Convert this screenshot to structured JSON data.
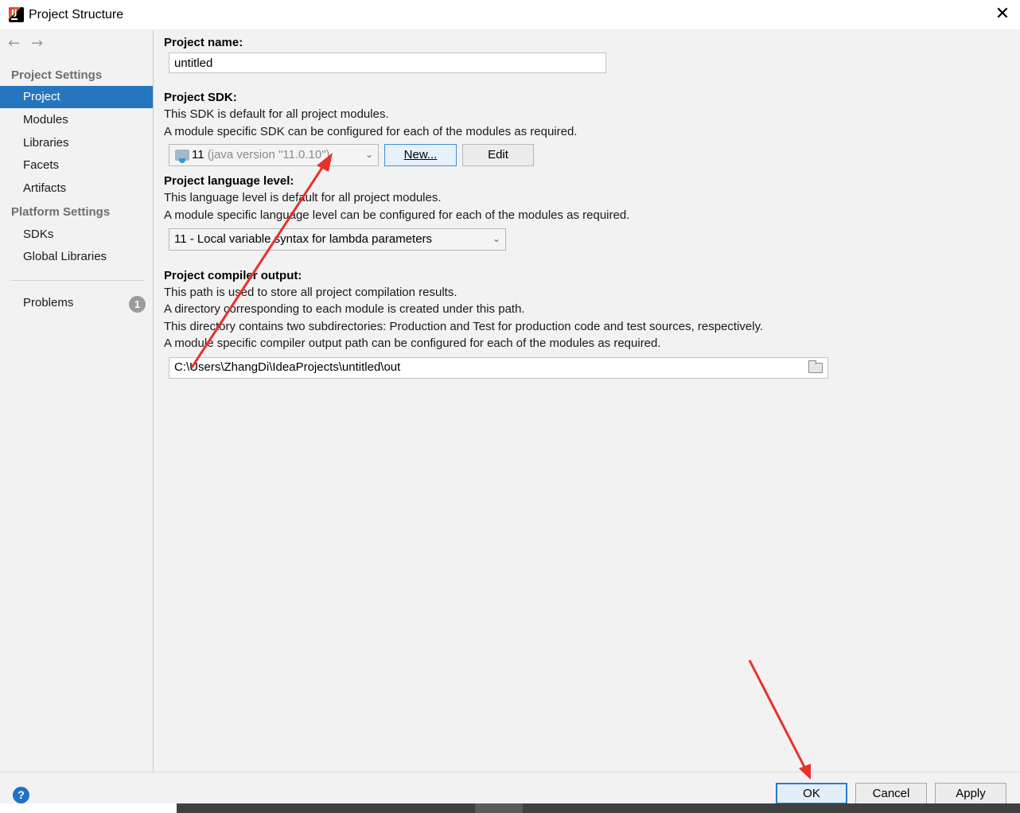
{
  "window": {
    "title": "Project Structure",
    "close_glyph": "✕"
  },
  "sidebar": {
    "back_glyph": "←",
    "forward_glyph": "→",
    "project_settings_title": "Project Settings",
    "project_items": [
      "Project",
      "Modules",
      "Libraries",
      "Facets",
      "Artifacts"
    ],
    "platform_settings_title": "Platform Settings",
    "platform_items": [
      "SDKs",
      "Global Libraries"
    ],
    "problems_label": "Problems",
    "problems_count": "1",
    "selected": "Project"
  },
  "project_name": {
    "label": "Project name:",
    "value": "untitled"
  },
  "project_sdk": {
    "label": "Project SDK:",
    "desc1": "This SDK is default for all project modules.",
    "desc2": "A module specific SDK can be configured for each of the modules as required.",
    "selected_version": "11",
    "selected_detail": " (java version \"11.0.10\")",
    "new_button": "New...",
    "edit_button": "Edit"
  },
  "language_level": {
    "label": "Project language level:",
    "desc1": "This language level is default for all project modules.",
    "desc2": "A module specific language level can be configured for each of the modules as required.",
    "selected": "11 - Local variable syntax for lambda parameters"
  },
  "compiler_output": {
    "label": "Project compiler output:",
    "desc1": "This path is used to store all project compilation results.",
    "desc2": "A directory corresponding to each module is created under this path.",
    "desc3": "This directory contains two subdirectories: Production and Test for production code and test sources, respectively.",
    "desc4": "A module specific compiler output path can be configured for each of the modules as required.",
    "path": "C:\\Users\\ZhangDi\\IdeaProjects\\untitled\\out"
  },
  "footer": {
    "help": "?",
    "ok": "OK",
    "cancel": "Cancel",
    "apply": "Apply"
  },
  "colors": {
    "selection": "#2675bf",
    "annotation_arrow": "#e8312a",
    "panel_bg": "#f2f2f2"
  }
}
